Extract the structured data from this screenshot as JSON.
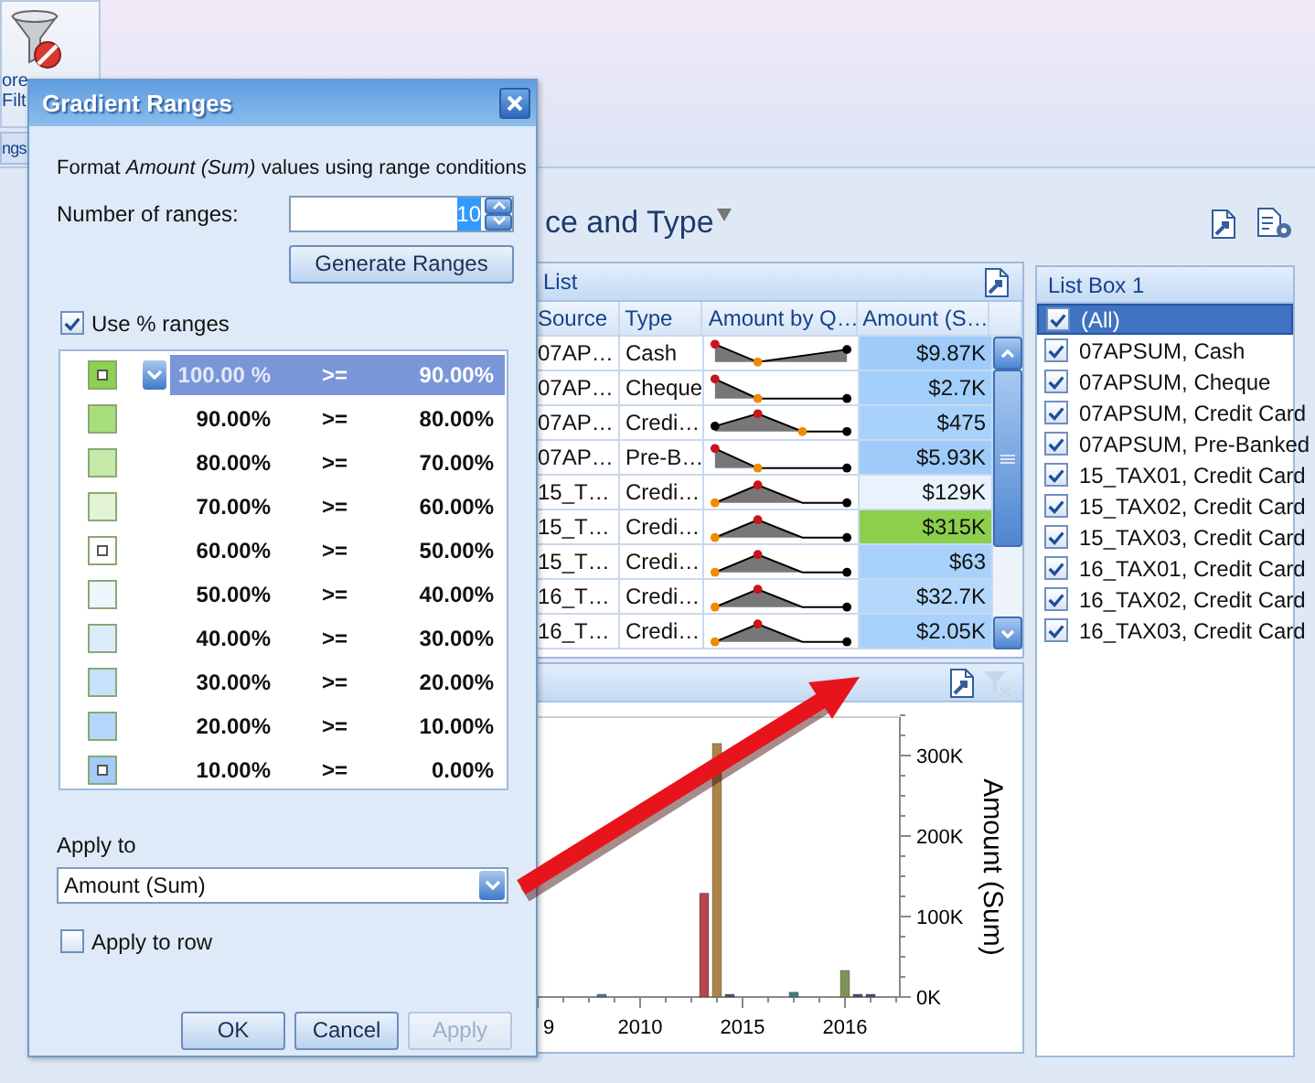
{
  "ribbon": {
    "button_lines": [
      "ore",
      "Filt"
    ],
    "tab": "ngs"
  },
  "dashboard": {
    "title": "ce and Type",
    "list_panel": {
      "title": "List",
      "columns": [
        "Source",
        "Type",
        "Amount by Q…",
        "Amount (S…"
      ],
      "rows": [
        {
          "source": "07AP…",
          "type": "Cash",
          "kind": "fall-rise",
          "amount": "$9.87K",
          "color": "#9ecbfa"
        },
        {
          "source": "07AP…",
          "type": "Cheque",
          "kind": "fall-flat",
          "amount": "$2.7K",
          "color": "#a3cffb"
        },
        {
          "source": "07AP…",
          "type": "Credi…",
          "kind": "peak-dip",
          "amount": "$475",
          "color": "#a8d2fb"
        },
        {
          "source": "07AP…",
          "type": "Pre-B…",
          "kind": "fall-flat",
          "amount": "$5.93K",
          "color": "#9ecbfa"
        },
        {
          "source": "15_T…",
          "type": "Credi…",
          "kind": "rise-peak",
          "amount": "$129K",
          "color": "#eaf3fd"
        },
        {
          "source": "15_T…",
          "type": "Credi…",
          "kind": "rise-peak",
          "amount": "$315K",
          "color": "#8ccf4d"
        },
        {
          "source": "15_T…",
          "type": "Credi…",
          "kind": "rise-peak",
          "amount": "$63",
          "color": "#a8d2fb"
        },
        {
          "source": "16_T…",
          "type": "Credi…",
          "kind": "rise-peak",
          "amount": "$32.7K",
          "color": "#b3d8fb"
        },
        {
          "source": "16_T…",
          "type": "Credi…",
          "kind": "rise-peak",
          "amount": "$2.05K",
          "color": "#a8d2fb"
        }
      ]
    },
    "chart_panel": {
      "chart_data": {
        "type": "bar",
        "ylabel": "Amount (Sum)",
        "categories": [
          "9",
          null,
          null,
          null,
          null,
          null,
          null,
          null,
          "2010",
          null,
          null,
          null,
          null,
          null,
          null,
          null,
          "2015",
          null,
          null,
          null,
          null,
          null,
          null,
          null,
          "2016",
          null,
          null,
          null
        ],
        "ylim": [
          0,
          350000
        ],
        "yticks": [
          {
            "value": 0,
            "label": "0K"
          },
          {
            "value": 100000,
            "label": "100K"
          },
          {
            "value": 200000,
            "label": "200K"
          },
          {
            "value": 300000,
            "label": "300K"
          }
        ],
        "series": [
          {
            "color": "#4a7a8c",
            "values": [
              null,
              null,
              null,
              null,
              null,
              3000,
              null,
              null,
              null,
              null,
              null,
              null,
              null,
              null,
              null,
              null,
              null,
              null,
              null,
              null,
              6000,
              null,
              null,
              null,
              null,
              null,
              null,
              null
            ]
          },
          {
            "color": "#b5454f",
            "values": [
              null,
              null,
              null,
              null,
              null,
              null,
              null,
              null,
              null,
              null,
              null,
              null,
              null,
              129000,
              null,
              null,
              null,
              null,
              null,
              null,
              null,
              null,
              null,
              null,
              null,
              null,
              null,
              null
            ]
          },
          {
            "color": "#ac8349",
            "values": [
              null,
              null,
              null,
              null,
              null,
              null,
              null,
              null,
              null,
              null,
              null,
              null,
              null,
              null,
              315000,
              null,
              null,
              null,
              null,
              null,
              null,
              null,
              null,
              null,
              null,
              null,
              null,
              null
            ]
          },
          {
            "color": "#555555",
            "values": [
              null,
              null,
              null,
              null,
              null,
              null,
              null,
              null,
              null,
              null,
              null,
              null,
              null,
              null,
              null,
              1000,
              null,
              null,
              null,
              null,
              null,
              null,
              null,
              null,
              null,
              null,
              null,
              null
            ]
          },
          {
            "color": "#7c9457",
            "values": [
              null,
              null,
              null,
              null,
              null,
              null,
              null,
              null,
              null,
              null,
              null,
              null,
              null,
              null,
              null,
              null,
              null,
              null,
              null,
              null,
              null,
              null,
              null,
              null,
              33000,
              null,
              null,
              null
            ]
          },
          {
            "color": "#5a4a7a",
            "values": [
              null,
              null,
              null,
              null,
              null,
              null,
              null,
              null,
              null,
              null,
              null,
              null,
              null,
              null,
              null,
              null,
              null,
              null,
              null,
              null,
              null,
              null,
              null,
              null,
              null,
              2000,
              null,
              null
            ]
          },
          {
            "color": "#3d4f7a",
            "values": [
              null,
              null,
              null,
              null,
              null,
              null,
              null,
              null,
              null,
              null,
              null,
              null,
              null,
              null,
              null,
              null,
              null,
              null,
              null,
              null,
              null,
              null,
              null,
              null,
              null,
              null,
              2000,
              null
            ]
          }
        ]
      }
    },
    "list_box": {
      "title": "List Box 1",
      "items": [
        {
          "label": "(All)",
          "checked": true,
          "selected": true
        },
        {
          "label": "07APSUM, Cash",
          "checked": true,
          "selected": false
        },
        {
          "label": "07APSUM, Cheque",
          "checked": true,
          "selected": false
        },
        {
          "label": "07APSUM, Credit Card",
          "checked": true,
          "selected": false
        },
        {
          "label": "07APSUM, Pre-Banked",
          "checked": true,
          "selected": false
        },
        {
          "label": "15_TAX01, Credit Card",
          "checked": true,
          "selected": false
        },
        {
          "label": "15_TAX02, Credit Card",
          "checked": true,
          "selected": false
        },
        {
          "label": "15_TAX03, Credit Card",
          "checked": true,
          "selected": false
        },
        {
          "label": "16_TAX01, Credit Card",
          "checked": true,
          "selected": false
        },
        {
          "label": "16_TAX02, Credit Card",
          "checked": true,
          "selected": false
        },
        {
          "label": "16_TAX03, Credit Card",
          "checked": true,
          "selected": false
        }
      ]
    }
  },
  "dialog": {
    "title": "Gradient Ranges",
    "description": "Format *Amount (Sum)* values using range conditions",
    "ranges_label": "Number of ranges:",
    "ranges_value": "10",
    "generate_button": "Generate Ranges",
    "use_percent": {
      "label": "Use % ranges",
      "checked": true
    },
    "ranges": [
      {
        "from": "100.00 %",
        "op": ">=",
        "to": "90.00%",
        "color": "#8cd14f",
        "marker": true,
        "selected": true
      },
      {
        "from": "90.00%",
        "op": ">=",
        "to": "80.00%",
        "color": "#a9de7c",
        "marker": false,
        "selected": false
      },
      {
        "from": "80.00%",
        "op": ">=",
        "to": "70.00%",
        "color": "#c5eaa8",
        "marker": false,
        "selected": false
      },
      {
        "from": "70.00%",
        "op": ">=",
        "to": "60.00%",
        "color": "#e2f4d3",
        "marker": false,
        "selected": false
      },
      {
        "from": "60.00%",
        "op": ">=",
        "to": "50.00%",
        "color": "#ffffff",
        "marker": true,
        "selected": false
      },
      {
        "from": "50.00%",
        "op": ">=",
        "to": "40.00%",
        "color": "#eef5fd",
        "marker": false,
        "selected": false
      },
      {
        "from": "40.00%",
        "op": ">=",
        "to": "30.00%",
        "color": "#dcebfc",
        "marker": false,
        "selected": false
      },
      {
        "from": "30.00%",
        "op": ">=",
        "to": "20.00%",
        "color": "#c8e1fc",
        "marker": false,
        "selected": false
      },
      {
        "from": "20.00%",
        "op": ">=",
        "to": "10.00%",
        "color": "#b5d6fb",
        "marker": false,
        "selected": false
      },
      {
        "from": "10.00%",
        "op": ">=",
        "to": "0.00%",
        "color": "#a2cbfa",
        "marker": true,
        "selected": false
      }
    ],
    "apply_to_label": "Apply to",
    "apply_to_value": "Amount (Sum)",
    "apply_to_row": {
      "label": "Apply to row",
      "checked": false
    },
    "buttons": [
      {
        "label": "OK",
        "disabled": false
      },
      {
        "label": "Cancel",
        "disabled": false
      },
      {
        "label": "Apply",
        "disabled": true
      }
    ]
  },
  "overlay_arrow": true
}
